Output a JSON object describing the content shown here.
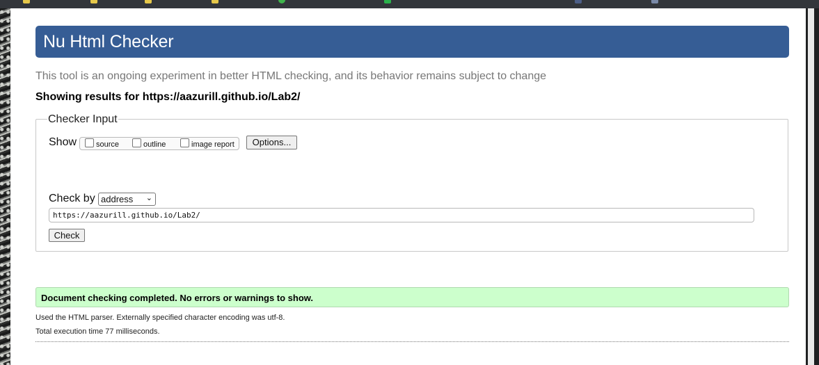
{
  "checker": {
    "title": "Nu Html Checker",
    "intro": "This tool is an ongoing experiment in better HTML checking, and its behavior remains subject to change",
    "results_for": "Showing results for https://aazurill.github.io/Lab2/"
  },
  "input": {
    "legend": "Checker Input",
    "show_label": "Show",
    "options": [
      {
        "label": "source",
        "checked": false
      },
      {
        "label": "outline",
        "checked": false
      },
      {
        "label": "image report",
        "checked": false
      }
    ],
    "options_button": "Options...",
    "check_by_label": "Check by",
    "check_by_value": "address",
    "url_value": "https://aazurill.github.io/Lab2/",
    "check_button": "Check"
  },
  "results": {
    "success": "Document checking completed. No errors or warnings to show.",
    "parser_info": "Used the HTML parser. Externally specified character encoding was utf-8.",
    "time_info": "Total execution time 77 milliseconds."
  },
  "colors": {
    "header_bg": "#365d95",
    "success_bg": "#ccffcc",
    "muted_text": "#777777"
  }
}
